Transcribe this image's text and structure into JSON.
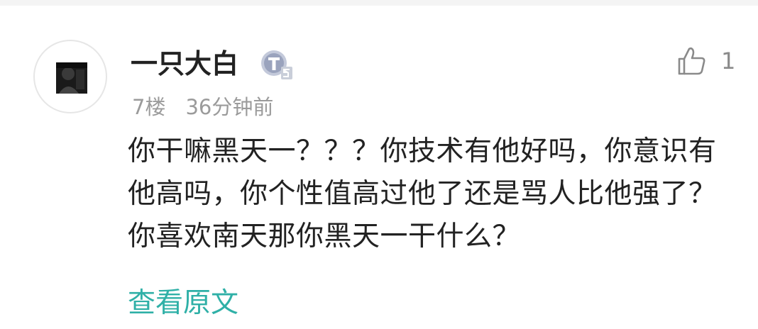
{
  "comment": {
    "username": "一只大白",
    "level_badge": "T3",
    "floor": "7楼",
    "time": "36分钟前",
    "likes": "1",
    "text": "你干嘛黑天一？？？你技术有他好吗，你意识有他高吗，你个性值高过他了还是骂人比他强了？你喜欢南天那你黑天一干什么？",
    "view_original_label": "查看原文"
  },
  "colors": {
    "link": "#2fb0a7",
    "meta": "#9b9b9b",
    "text": "#222222",
    "badge": "#b0b8d0"
  },
  "icons": {
    "like": "thumbs-up-icon",
    "badge": "level-badge-icon"
  }
}
